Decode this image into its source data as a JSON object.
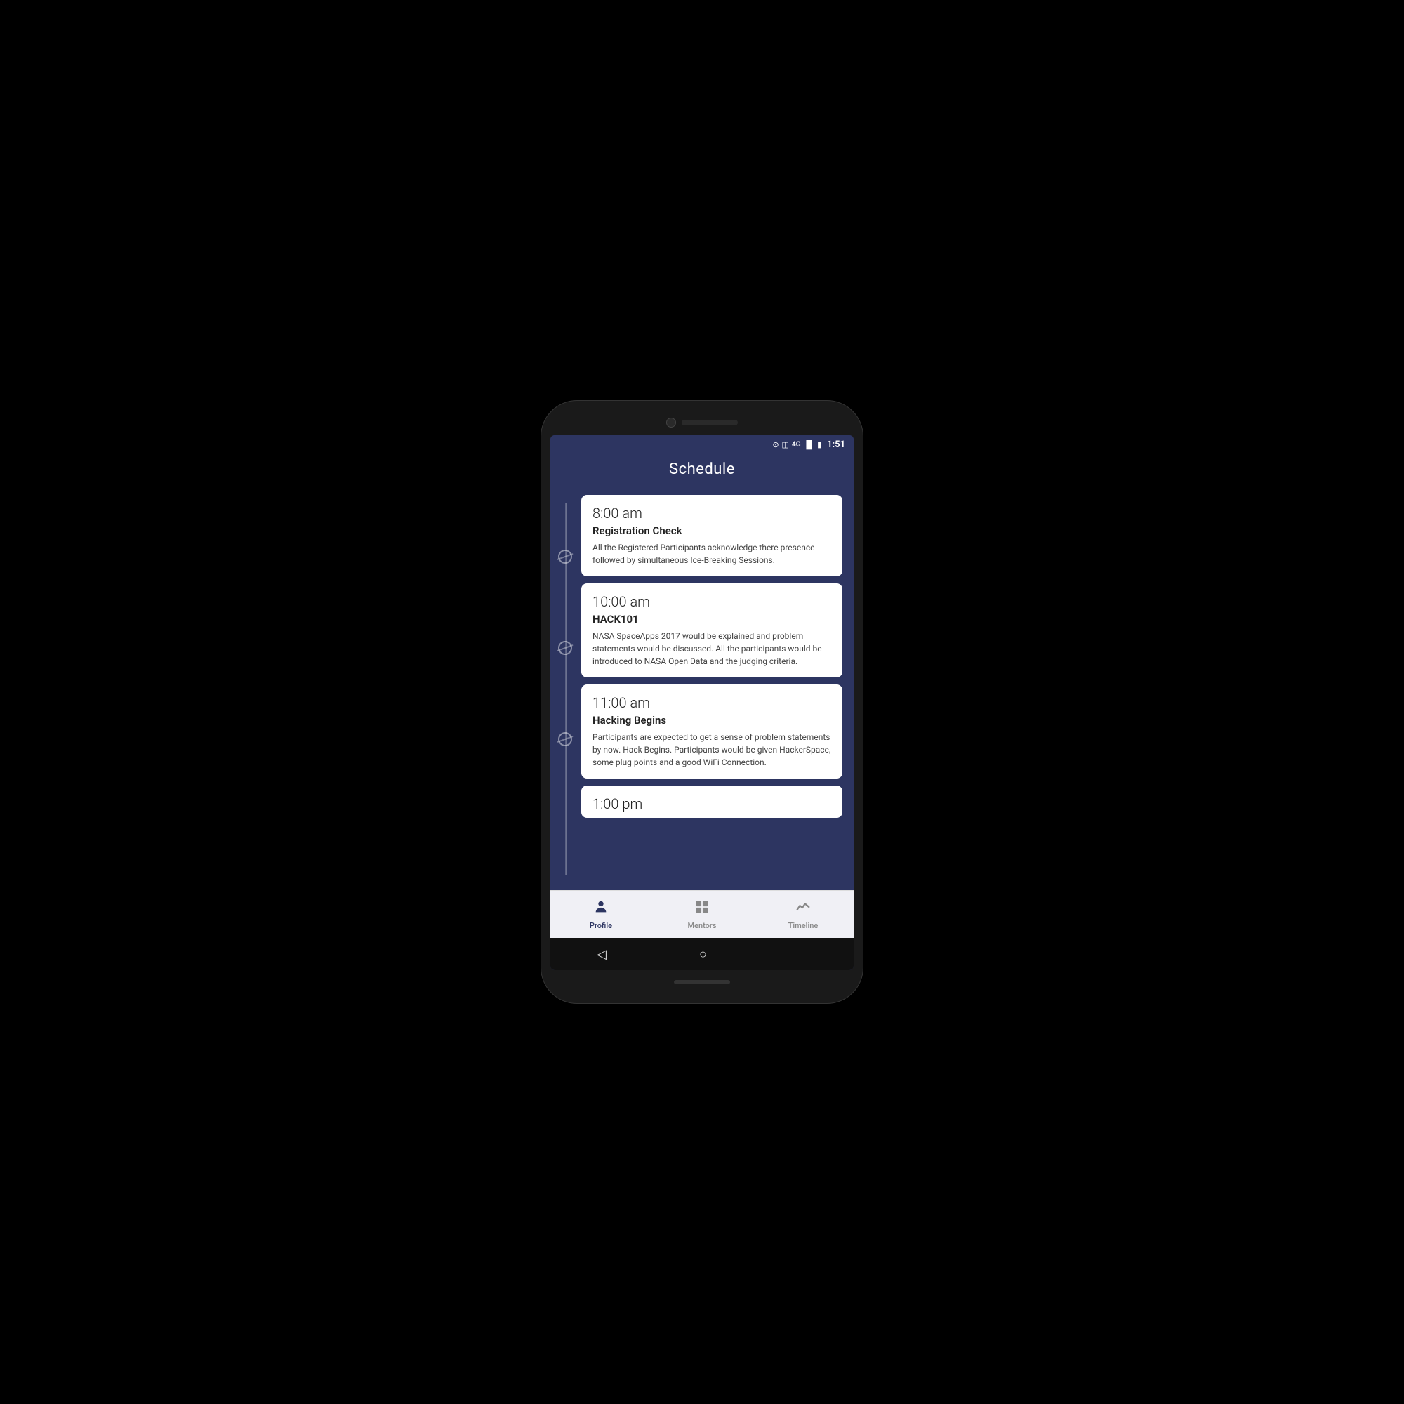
{
  "status": {
    "time": "1:51",
    "signal_label": "4G",
    "battery_label": "battery"
  },
  "header": {
    "title": "Schedule"
  },
  "schedule": {
    "items": [
      {
        "time": "8:00 am",
        "title": "Registration Check",
        "description": "All the Registered Participants acknowledge there presence followed by simultaneous Ice-Breaking Sessions."
      },
      {
        "time": "10:00 am",
        "title": "HACK101",
        "description": "NASA SpaceApps 2017 would be explained and problem statements would be discussed. All the participants would be introduced to NASA Open Data and the judging criteria."
      },
      {
        "time": "11:00 am",
        "title": "Hacking Begins",
        "description": "Participants are expected to get a sense of problem statements by now. Hack Begins. Participants would be given HackerSpace, some plug points and a good WiFi Connection."
      },
      {
        "time": "1:00 pm",
        "title": "",
        "description": ""
      }
    ]
  },
  "nav": {
    "items": [
      {
        "label": "Profile",
        "icon": "person"
      },
      {
        "label": "Mentors",
        "icon": "grid"
      },
      {
        "label": "Timeline",
        "icon": "timeline"
      }
    ]
  },
  "android_nav": {
    "back": "◁",
    "home": "○",
    "recent": "□"
  }
}
